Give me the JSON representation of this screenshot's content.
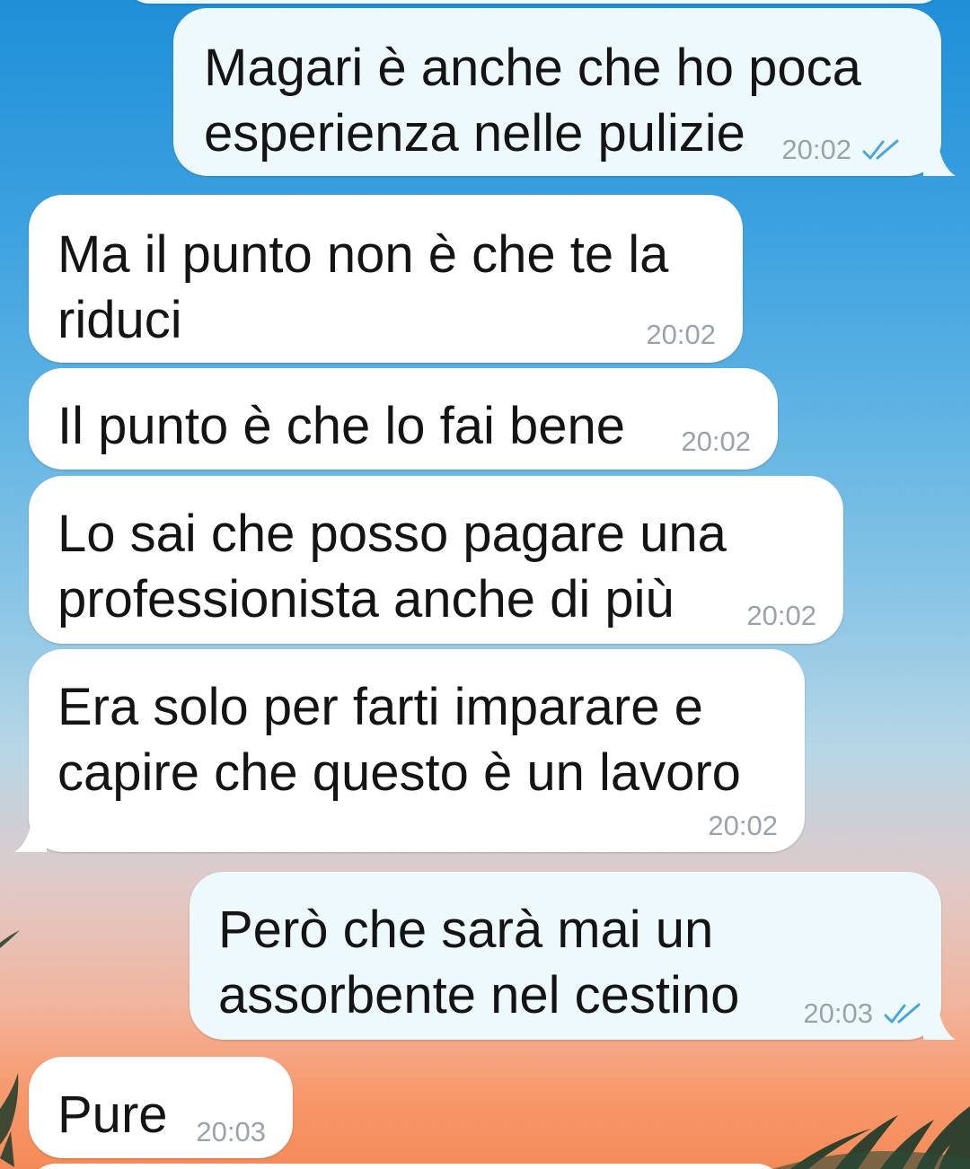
{
  "chat": {
    "messages": [
      {
        "direction": "out",
        "text": "Magari è anche che ho poca esperienza nelle pulizie",
        "time": "20:02",
        "status": "read-double-tick"
      },
      {
        "direction": "in",
        "text": "Ma il punto non è che te la riduci",
        "time": "20:02"
      },
      {
        "direction": "in",
        "text": "Il punto è che lo fai bene",
        "time": "20:02"
      },
      {
        "direction": "in",
        "text": "Lo sai che posso pagare una professionista anche di più",
        "time": "20:02"
      },
      {
        "direction": "in",
        "text": "Era solo per farti imparare e capire che questo è un lavoro",
        "time": "20:02"
      },
      {
        "direction": "out",
        "text": "Però che sarà mai un assorbente nel cestino",
        "time": "20:03",
        "status": "read-double-tick"
      },
      {
        "direction": "in",
        "text": "Pure",
        "time": "20:03"
      }
    ]
  },
  "colors": {
    "incoming_bubble": "#ffffff",
    "outgoing_bubble": "#eef9fd",
    "read_ticks": "#4aa6d8",
    "timestamp": "#9aa3aa"
  }
}
